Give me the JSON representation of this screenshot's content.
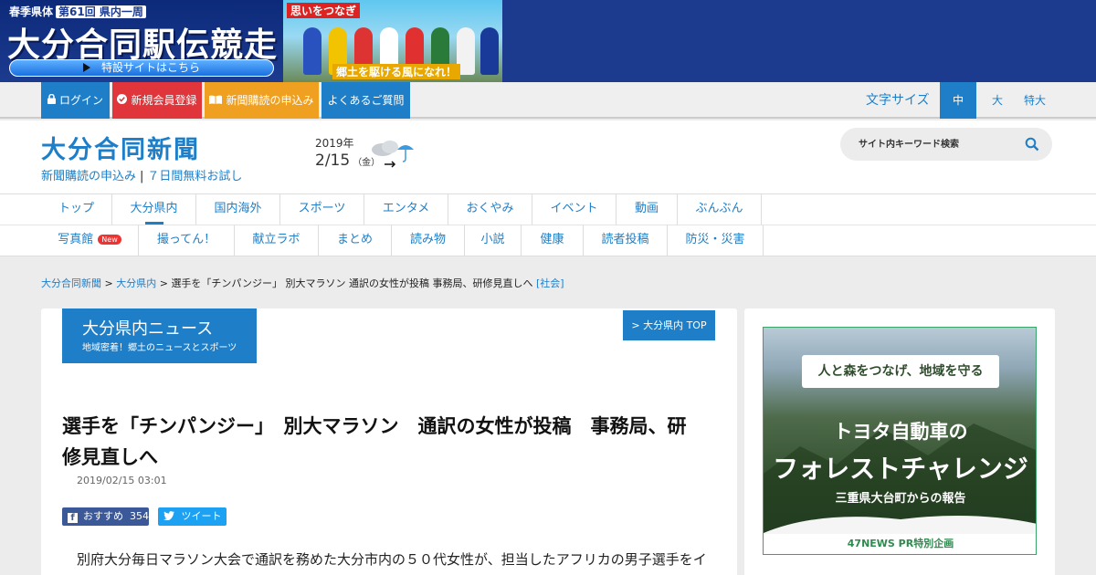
{
  "colors": {
    "brand_blue": "#1e7fc8",
    "banner_navy": "#1c3b8f",
    "signup_red": "#e0353b",
    "subscribe_orange": "#f0a020",
    "facebook_blue": "#3b5998",
    "twitter_blue": "#1da1f2"
  },
  "top_banner": {
    "ekiden_kicker": "春季県体",
    "ekiden_kicker_hl": "第61回 県内一周",
    "ekiden_title": "大分合同駅伝競走",
    "ekiden_button": "特設サイトはこちら",
    "slogan_1": "思いをつなぎ",
    "slogan_2": "郷土を駆ける風になれ！"
  },
  "utility": {
    "login": "ログイン",
    "signup": "新規会員登録",
    "subscribe": "新聞購読の申込み",
    "faq": "よくあるご質問",
    "font_size_label": "文字サイズ",
    "font_sizes": [
      "中",
      "大",
      "特大"
    ],
    "font_size_active": "中"
  },
  "header": {
    "logo": "大分合同新聞",
    "subscribe_link": "新聞購読の申込み",
    "trial_link": "７日間無料お試し",
    "date_year": "2019年",
    "date_day": "2/15",
    "date_weekday": "（金）",
    "weather_icon": "cloudy-then-rain-icon",
    "search_placeholder": "サイト内キーワード検索"
  },
  "nav_primary": [
    "トップ",
    "大分県内",
    "国内海外",
    "スポーツ",
    "エンタメ",
    "おくやみ",
    "イベント",
    "動画",
    "ぶんぶん"
  ],
  "nav_primary_active": "大分県内",
  "nav_secondary": [
    "写真館",
    "撮ってん！",
    "献立ラボ",
    "まとめ",
    "読み物",
    "小説",
    "健康",
    "読者投稿",
    "防災・災害"
  ],
  "nav_secondary_badge": "New",
  "breadcrumb": {
    "home": "大分合同新聞",
    "section": "大分県内",
    "current": "選手を「チンパンジー」 別大マラソン 通訳の女性が投稿 事務局、研修見直しへ",
    "category": "[社会]"
  },
  "section": {
    "title": "大分県内ニュース",
    "subtitle": "地域密着！郷土のニュースとスポーツ",
    "top_link": "> 大分県内 TOP"
  },
  "article": {
    "title": "選手を「チンパンジー」　別大マラソン　通訳の女性が投稿　事務局、研修見直しへ",
    "date": "2019/02/15 03:01",
    "fb_label": "おすすめ",
    "fb_count": "354",
    "tweet_label": "ツイート",
    "body_first_line": "別府大分毎日マラソン大会で通訳を務めた大分市内の５０代女性が、担当したアフリカの男子選手をイ"
  },
  "ad": {
    "banner": "人と森をつなげ、地域を守る",
    "line1": "トヨタ自動車の",
    "line2": "フォレストチャレンジ",
    "line3": "三重県大台町からの報告",
    "footer": "47NEWS PR特別企画"
  }
}
